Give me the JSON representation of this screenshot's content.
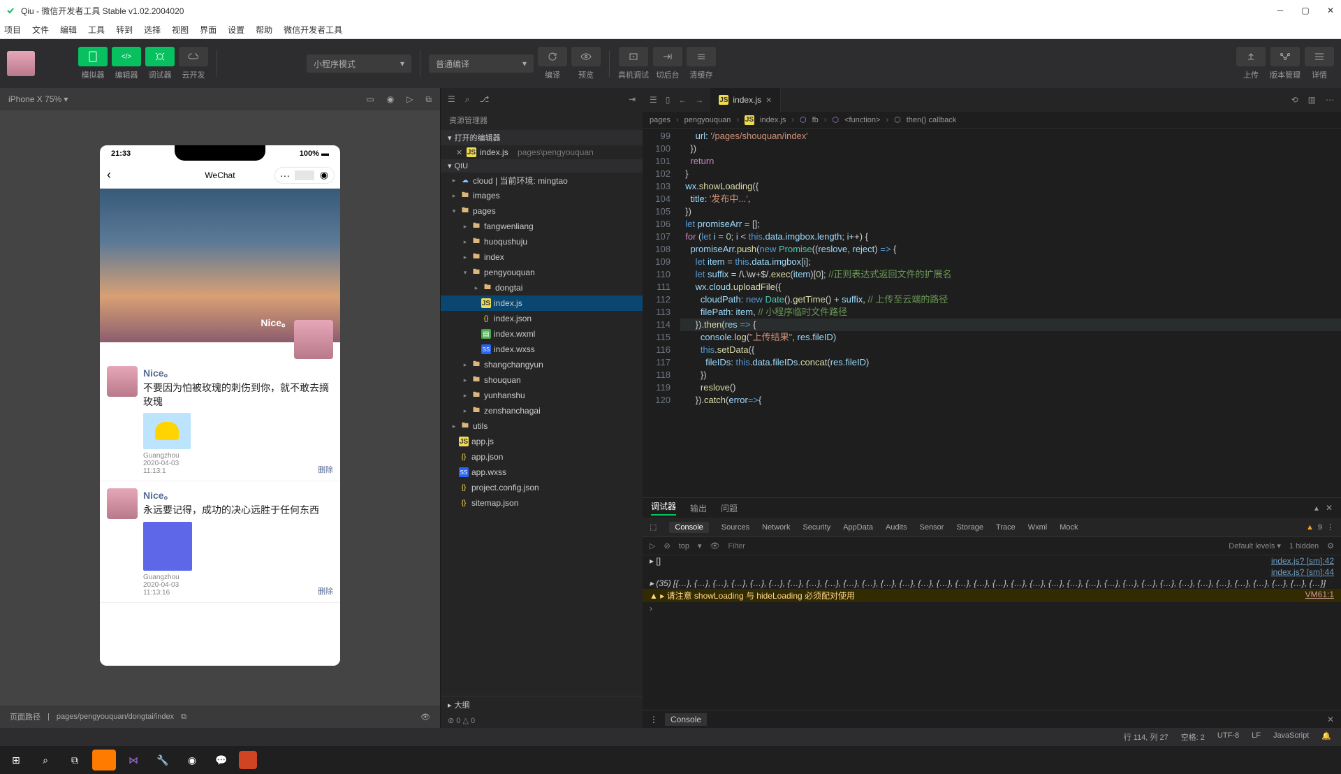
{
  "title": "Qiu - 微信开发者工具 Stable v1.02.2004020",
  "menu": [
    "项目",
    "文件",
    "编辑",
    "工具",
    "转到",
    "选择",
    "视图",
    "界面",
    "设置",
    "帮助",
    "微信开发者工具"
  ],
  "toolbar": {
    "simulator": "模拟器",
    "editor": "编辑器",
    "debugger": "调试器",
    "cloud": "云开发",
    "mode": "小程序模式",
    "compile_mode": "普通编译",
    "compile": "编译",
    "preview": "预览",
    "remote": "真机调试",
    "background": "切后台",
    "clearcache": "清缓存",
    "upload": "上传",
    "version": "版本管理",
    "detail": "详情"
  },
  "sim": {
    "device": "iPhone X 75% ▾",
    "time": "21:33",
    "signal": "100%",
    "title": "WeChat",
    "pathLabel": "页面路径",
    "path": "pages/pengyouquan/dongtai/index"
  },
  "hero_name": "Nice。",
  "posts": [
    {
      "name": "Nice。",
      "text": "不要因为怕被玫瑰的刺伤到你，就不敢去摘玫瑰",
      "loc": "Guangzhou",
      "date": "2020-04-03",
      "t": "11:13:1",
      "del": "删除"
    },
    {
      "name": "Nice。",
      "text": "永远要记得，成功的决心远胜于任何东西",
      "loc": "Guangzhou",
      "date": "2020-04-03",
      "t": "11:13:16",
      "del": "删除"
    }
  ],
  "explorer": {
    "title": "资源管理器",
    "open": "打开的编辑器",
    "openfile": "index.js",
    "openpath": "pages\\pengyouquan",
    "root": "QIU",
    "outline": "大纲",
    "tree": {
      "cloud": "cloud | 当前环境: mingtao",
      "images": "images",
      "pages": "pages",
      "fangwenliang": "fangwenliang",
      "huoqushuju": "huoqushuju",
      "index": "index",
      "pengyouquan": "pengyouquan",
      "dongtai": "dongtai",
      "indexjs": "index.js",
      "indexjson": "index.json",
      "indexwxml": "index.wxml",
      "indexwxss": "index.wxss",
      "shangchangyun": "shangchangyun",
      "shouquan": "shouquan",
      "yunhanshu": "yunhanshu",
      "zenshanchagai": "zenshanchagai",
      "utils": "utils",
      "appjs": "app.js",
      "appjson": "app.json",
      "appwxss": "app.wxss",
      "projconf": "project.config.json",
      "sitemap": "sitemap.json"
    },
    "stats": "⊘ 0 △ 0"
  },
  "editor": {
    "tab": "index.js",
    "crumb": [
      "pages",
      "pengyouquan",
      "index.js",
      "fb",
      "<function>",
      "then() callback"
    ]
  },
  "code_lines": [
    "99",
    "100",
    "101",
    "102",
    "103",
    "104",
    "105",
    "106",
    "107",
    "108",
    "109",
    "110",
    "111",
    "112",
    "113",
    "114",
    "115",
    "116",
    "117",
    "118",
    "119",
    "120"
  ],
  "debug": {
    "tabs": [
      "调试器",
      "输出",
      "问题"
    ],
    "tools": [
      "Console",
      "Sources",
      "Network",
      "Security",
      "AppData",
      "Audits",
      "Sensor",
      "Storage",
      "Trace",
      "Wxml",
      "Mock"
    ],
    "warn": "9",
    "top": "top",
    "levels": "Default levels ▾",
    "hidden": "1 hidden",
    "filter": "Filter",
    "l1": "▸ []",
    "s1": "index.js? [sm]:42",
    "s2": "index.js? [sm]:44",
    "l2": "▸ (35) [{…}, {…}, {…}, {…}, {…}, {…}, {…}, {…}, {…}, {…}, {…}, {…}, {…}, {…}, {…}, {…}, {…}, {…}, {…}, {…}, {…}, {…}, {…}, {…}, {…}, {…}, {…}, {…}, {…}, {…}, {…}, {…}, {…}, {…}, {…}]",
    "l3": "▲ ▸ 请注意 showLoading 与 hideLoading 必须配对使用",
    "s3": "VM61:1",
    "bottab": "Console"
  },
  "status": {
    "line": "行 114, 列 27",
    "spaces": "空格: 2",
    "enc": "UTF-8",
    "eol": "LF",
    "lang": "JavaScript"
  }
}
